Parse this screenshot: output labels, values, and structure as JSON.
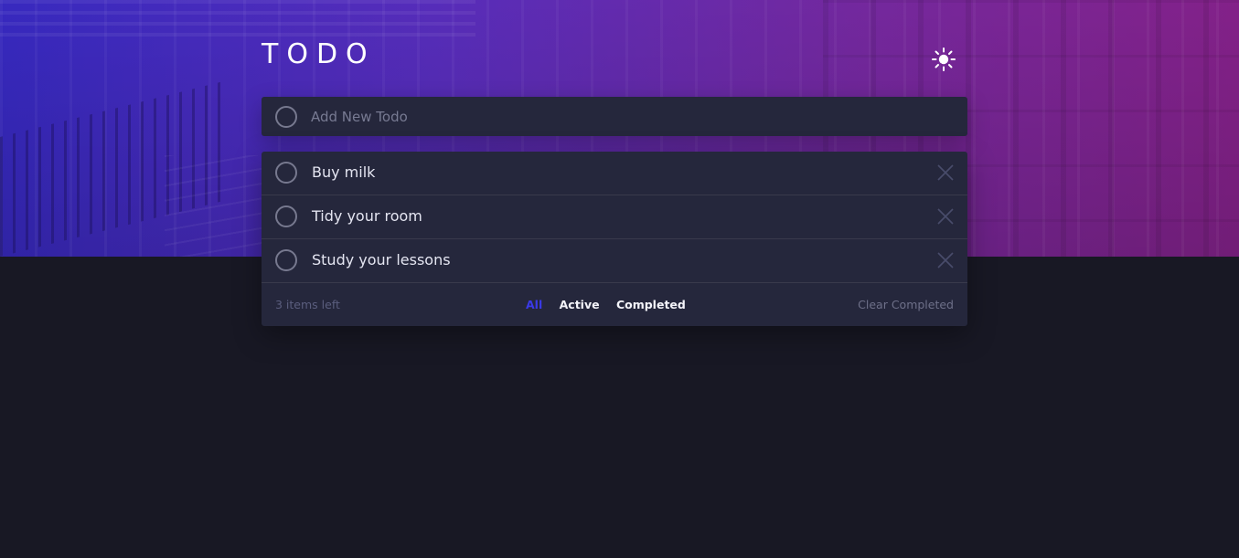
{
  "header": {
    "title": "TODO",
    "theme_icon": "sun-icon"
  },
  "new_todo": {
    "placeholder": "Add New Todo",
    "value": ""
  },
  "todos": [
    {
      "text": "Buy milk",
      "completed": false
    },
    {
      "text": "Tidy your room",
      "completed": false
    },
    {
      "text": "Study your lessons",
      "completed": false
    }
  ],
  "footer": {
    "items_left": "3 items left",
    "filters": {
      "all": "All",
      "active": "Active",
      "completed": "Completed",
      "selected": "all"
    },
    "clear_completed": "Clear Completed"
  },
  "colors": {
    "background": "#181824",
    "card": "#25273c",
    "text": "#e4e5f1",
    "muted": "#5b5e7e",
    "accent_blue": "#3a3ae8",
    "hero_gradient_start": "#3a2bc9",
    "hero_gradient_end": "#8a2390"
  }
}
